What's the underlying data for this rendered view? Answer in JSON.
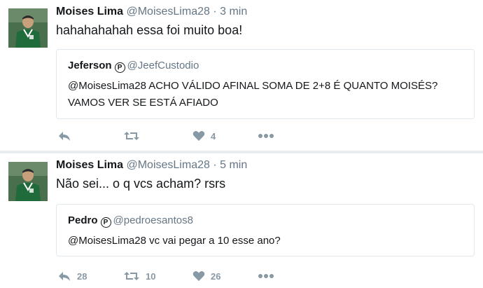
{
  "tweets": [
    {
      "author_name": "Moises Lima",
      "author_handle": "@MoisesLima28",
      "separator": "·",
      "time": "3 min",
      "text": "hahahahahah essa foi muito boa!",
      "quote": {
        "name": "Jeferson",
        "badge": "P",
        "handle": "@JeefCustodio",
        "text": "@MoisesLima28 ACHO VÁLIDO AFINAL SOMA DE 2+8 É QUANTO MOISÉS? VAMOS VER SE ESTÁ AFIADO"
      },
      "actions": {
        "reply": "",
        "retweet": "",
        "like": "4"
      }
    },
    {
      "author_name": "Moises Lima",
      "author_handle": "@MoisesLima28",
      "separator": "·",
      "time": "5 min",
      "text": "Não sei... o q vcs acham? rsrs",
      "quote": {
        "name": "Pedro",
        "badge": "P",
        "handle": "@pedroesantos8",
        "text": "@MoisesLima28 vc vai pegar a 10 esse ano?"
      },
      "actions": {
        "reply": "28",
        "retweet": "10",
        "like": "26"
      }
    }
  ],
  "colors": {
    "name": "#14171a",
    "muted": "#657786",
    "action_icon": "#8899a6",
    "border": "#e1e8ed",
    "divider": "#e6ecf0"
  },
  "icons": [
    "reply-icon",
    "retweet-icon",
    "heart-icon",
    "more-icon",
    "verified-badge-icon"
  ]
}
